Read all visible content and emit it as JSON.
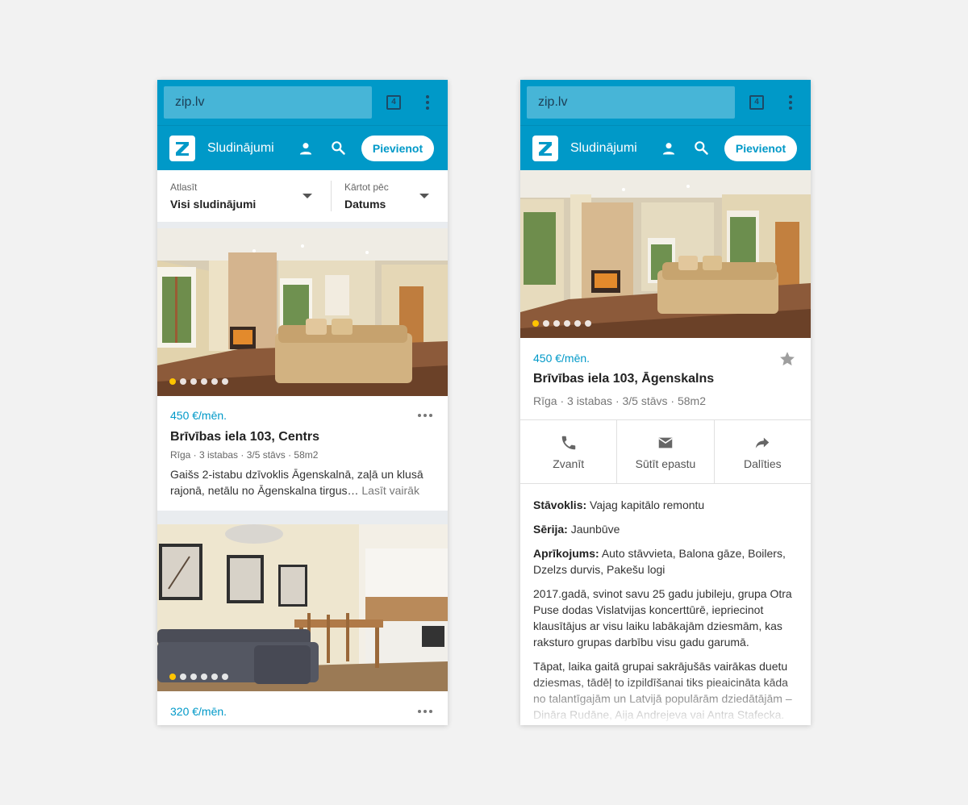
{
  "screens": {
    "list": {
      "browser": {
        "url": "zip.lv",
        "tab_count": "4"
      },
      "app": {
        "title": "Sludinājumi",
        "add_label": "Pievienot"
      },
      "filters": {
        "filter": {
          "label": "Atlasīt",
          "value": "Visi sludinājumi"
        },
        "sort": {
          "label": "Kārtot pēc",
          "value": "Datums"
        }
      },
      "cards": [
        {
          "price": "450 €/mēn.",
          "title": "Brīvības iela 103, Centrs",
          "meta": "Rīga · 3 istabas · 3/5 stāvs · 58m2",
          "description": "Gaišs 2-istabu dzīvoklis Āgenskalnā, zaļā un klusā rajonā, netālu no Āgenskalna tirgus…",
          "read_more": "Lasīt vairāk",
          "photo_total": 6,
          "photo_active": 1
        },
        {
          "price": "320 €/mēn.",
          "photo_total": 6,
          "photo_active": 1
        }
      ]
    },
    "detail": {
      "browser": {
        "url": "zip.lv",
        "tab_count": "4"
      },
      "app": {
        "title": "Sludinājumi",
        "add_label": "Pievienot"
      },
      "price": "450 €/mēn.",
      "title": "Brīvības iela 103, Āgenskalns",
      "meta": "Rīga · 3 istabas · 3/5 stāvs · 58m2",
      "photo_total": 6,
      "photo_active": 1,
      "actions": [
        {
          "label": "Zvanīt",
          "icon": "phone-icon"
        },
        {
          "label": "Sūtīt epastu",
          "icon": "mail-icon"
        },
        {
          "label": "Dalīties",
          "icon": "share-icon"
        }
      ],
      "fields": [
        {
          "key": "Stāvoklis:",
          "value": "Vajag kapitālo remontu"
        },
        {
          "key": "Sērija:",
          "value": "Jaunbūve"
        },
        {
          "key": "Aprīkojums:",
          "value": "Auto stāvvieta, Balona gāze, Boilers, Dzelzs durvis, Pakešu logi"
        }
      ],
      "paragraphs": [
        "2017.gadā, svinot savu 25 gadu jubileju, grupa Otra Puse dodas Vislatvijas koncerttūrē, iepriecinot klausītājus ar visu laiku labākajām dziesmām, kas raksturo grupas darbību visu gadu garumā.",
        "Tāpat, laika gaitā grupai sakrājušās vairākas duetu dziesmas, tādēļ to izpildīšanai tiks pieaicināta kāda no talantīgajām un Latvijā populārām dziedātājām – Dināra Rudāne, Aija Andrejeva vai Antra Stafecka."
      ]
    }
  },
  "colors": {
    "brand": "#0099c8",
    "active_dot": "#ffc400",
    "background": "#f2f2f2"
  }
}
